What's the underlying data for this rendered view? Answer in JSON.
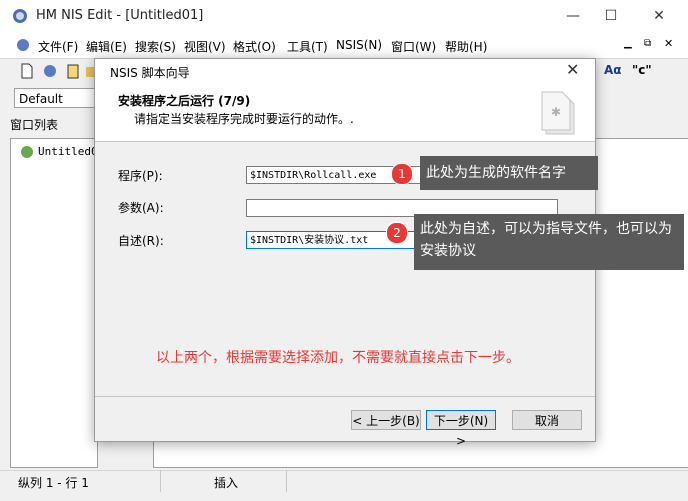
{
  "window": {
    "title": "HM NIS Edit - [Untitled01]",
    "minimize": "—",
    "maximize": "☐",
    "close": "✕"
  },
  "menu": [
    "文件(F)",
    "编辑(E)",
    "搜索(S)",
    "视图(V)",
    "格式(O)",
    "工具(T)",
    "NSIS(N)",
    "窗口(W)",
    "帮助(H)"
  ],
  "toolbar": {
    "style_value": "Default",
    "right_icons": [
      "Aα",
      "\"c\""
    ]
  },
  "left_panel": {
    "header": "窗口列表",
    "items": [
      "Untitled01"
    ]
  },
  "statusbar": {
    "position": "纵列 1 - 行 1",
    "mode": "插入"
  },
  "dialog": {
    "title": "NSIS 脚本向导",
    "heading": "安装程序之后运行 (7/9)",
    "subheading": "请指定当安装程序完成时要运行的动作。.",
    "fields": {
      "program_label": "程序(P):",
      "program_value": "$INSTDIR\\Rollcall.exe",
      "params_label": "参数(A):",
      "params_value": "",
      "readme_label": "自述(R):",
      "readme_value": "$INSTDIR\\安装协议.txt"
    },
    "note": "以上两个，根据需要选择添加，不需要就直接点击下一步。",
    "buttons": {
      "back": "< 上一步(B)",
      "next": "下一步(N) >",
      "cancel": "取消"
    }
  },
  "annotations": [
    {
      "num": "1",
      "text": "此处为生成的软件名字"
    },
    {
      "num": "2",
      "text": "此处为自述，可以为指导文件，也可以为安装协议"
    }
  ],
  "colors": {
    "accent": "#e53935",
    "tip_bg": "#5a5a5a"
  }
}
